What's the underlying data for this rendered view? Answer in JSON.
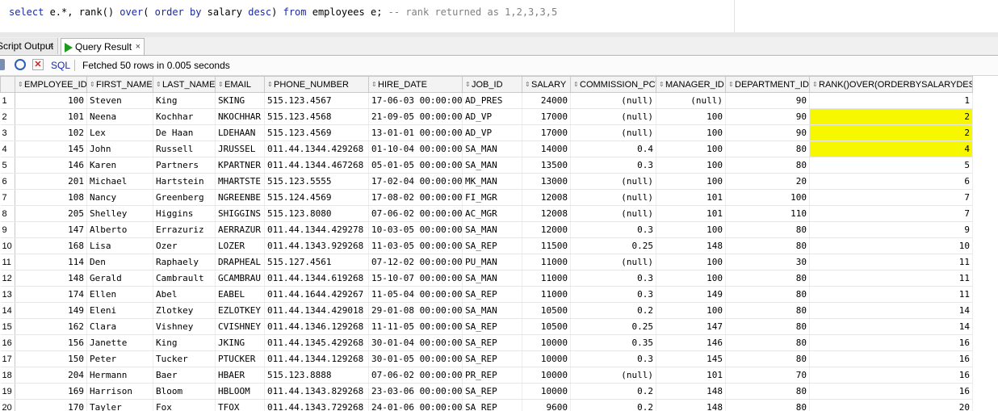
{
  "editor": {
    "tokens": [
      {
        "t": "select",
        "c": "kw"
      },
      {
        "t": " e.*, rank() ",
        "c": "pl"
      },
      {
        "t": "over",
        "c": "kw"
      },
      {
        "t": "( ",
        "c": "pl"
      },
      {
        "t": "order by",
        "c": "kw"
      },
      {
        "t": " salary ",
        "c": "pl"
      },
      {
        "t": "desc",
        "c": "kw"
      },
      {
        "t": ") ",
        "c": "pl"
      },
      {
        "t": "from",
        "c": "kw"
      },
      {
        "t": " employees e; ",
        "c": "pl"
      },
      {
        "t": "-- rank returned as 1,2,3,3,5",
        "c": "cm"
      }
    ]
  },
  "tabs": {
    "script_output": "Script Output",
    "query_result": "Query Result",
    "close_glyph": "×"
  },
  "toolbar": {
    "sql_label": "SQL",
    "status": "Fetched 50 rows in 0.005 seconds"
  },
  "grid": {
    "columns": [
      "EMPLOYEE_ID",
      "FIRST_NAME",
      "LAST_NAME",
      "EMAIL",
      "PHONE_NUMBER",
      "HIRE_DATE",
      "JOB_ID",
      "SALARY",
      "COMMISSION_PCT",
      "MANAGER_ID",
      "DEPARTMENT_ID",
      "RANK()OVER(ORDERBYSALARYDESC)"
    ],
    "numeric": [
      true,
      false,
      false,
      false,
      false,
      false,
      false,
      true,
      true,
      true,
      true,
      true
    ],
    "highlight_rows": [
      2,
      3,
      4
    ],
    "rows": [
      [
        "100",
        "Steven",
        "King",
        "SKING",
        "515.123.4567",
        "17-06-03 00:00:00",
        "AD_PRES",
        "24000",
        "(null)",
        "(null)",
        "90",
        "1"
      ],
      [
        "101",
        "Neena",
        "Kochhar",
        "NKOCHHAR",
        "515.123.4568",
        "21-09-05 00:00:00",
        "AD_VP",
        "17000",
        "(null)",
        "100",
        "90",
        "2"
      ],
      [
        "102",
        "Lex",
        "De Haan",
        "LDEHAAN",
        "515.123.4569",
        "13-01-01 00:00:00",
        "AD_VP",
        "17000",
        "(null)",
        "100",
        "90",
        "2"
      ],
      [
        "145",
        "John",
        "Russell",
        "JRUSSEL",
        "011.44.1344.429268",
        "01-10-04 00:00:00",
        "SA_MAN",
        "14000",
        "0.4",
        "100",
        "80",
        "4"
      ],
      [
        "146",
        "Karen",
        "Partners",
        "KPARTNER",
        "011.44.1344.467268",
        "05-01-05 00:00:00",
        "SA_MAN",
        "13500",
        "0.3",
        "100",
        "80",
        "5"
      ],
      [
        "201",
        "Michael",
        "Hartstein",
        "MHARTSTE",
        "515.123.5555",
        "17-02-04 00:00:00",
        "MK_MAN",
        "13000",
        "(null)",
        "100",
        "20",
        "6"
      ],
      [
        "108",
        "Nancy",
        "Greenberg",
        "NGREENBE",
        "515.124.4569",
        "17-08-02 00:00:00",
        "FI_MGR",
        "12008",
        "(null)",
        "101",
        "100",
        "7"
      ],
      [
        "205",
        "Shelley",
        "Higgins",
        "SHIGGINS",
        "515.123.8080",
        "07-06-02 00:00:00",
        "AC_MGR",
        "12008",
        "(null)",
        "101",
        "110",
        "7"
      ],
      [
        "147",
        "Alberto",
        "Errazuriz",
        "AERRAZUR",
        "011.44.1344.429278",
        "10-03-05 00:00:00",
        "SA_MAN",
        "12000",
        "0.3",
        "100",
        "80",
        "9"
      ],
      [
        "168",
        "Lisa",
        "Ozer",
        "LOZER",
        "011.44.1343.929268",
        "11-03-05 00:00:00",
        "SA_REP",
        "11500",
        "0.25",
        "148",
        "80",
        "10"
      ],
      [
        "114",
        "Den",
        "Raphaely",
        "DRAPHEAL",
        "515.127.4561",
        "07-12-02 00:00:00",
        "PU_MAN",
        "11000",
        "(null)",
        "100",
        "30",
        "11"
      ],
      [
        "148",
        "Gerald",
        "Cambrault",
        "GCAMBRAU",
        "011.44.1344.619268",
        "15-10-07 00:00:00",
        "SA_MAN",
        "11000",
        "0.3",
        "100",
        "80",
        "11"
      ],
      [
        "174",
        "Ellen",
        "Abel",
        "EABEL",
        "011.44.1644.429267",
        "11-05-04 00:00:00",
        "SA_REP",
        "11000",
        "0.3",
        "149",
        "80",
        "11"
      ],
      [
        "149",
        "Eleni",
        "Zlotkey",
        "EZLOTKEY",
        "011.44.1344.429018",
        "29-01-08 00:00:00",
        "SA_MAN",
        "10500",
        "0.2",
        "100",
        "80",
        "14"
      ],
      [
        "162",
        "Clara",
        "Vishney",
        "CVISHNEY",
        "011.44.1346.129268",
        "11-11-05 00:00:00",
        "SA_REP",
        "10500",
        "0.25",
        "147",
        "80",
        "14"
      ],
      [
        "156",
        "Janette",
        "King",
        "JKING",
        "011.44.1345.429268",
        "30-01-04 00:00:00",
        "SA_REP",
        "10000",
        "0.35",
        "146",
        "80",
        "16"
      ],
      [
        "150",
        "Peter",
        "Tucker",
        "PTUCKER",
        "011.44.1344.129268",
        "30-01-05 00:00:00",
        "SA_REP",
        "10000",
        "0.3",
        "145",
        "80",
        "16"
      ],
      [
        "204",
        "Hermann",
        "Baer",
        "HBAER",
        "515.123.8888",
        "07-06-02 00:00:00",
        "PR_REP",
        "10000",
        "(null)",
        "101",
        "70",
        "16"
      ],
      [
        "169",
        "Harrison",
        "Bloom",
        "HBLOOM",
        "011.44.1343.829268",
        "23-03-06 00:00:00",
        "SA_REP",
        "10000",
        "0.2",
        "148",
        "80",
        "16"
      ],
      [
        "170",
        "Tayler",
        "Fox",
        "TFOX",
        "011.44.1343.729268",
        "24-01-06 00:00:00",
        "SA_REP",
        "9600",
        "0.2",
        "148",
        "80",
        "20"
      ]
    ]
  }
}
